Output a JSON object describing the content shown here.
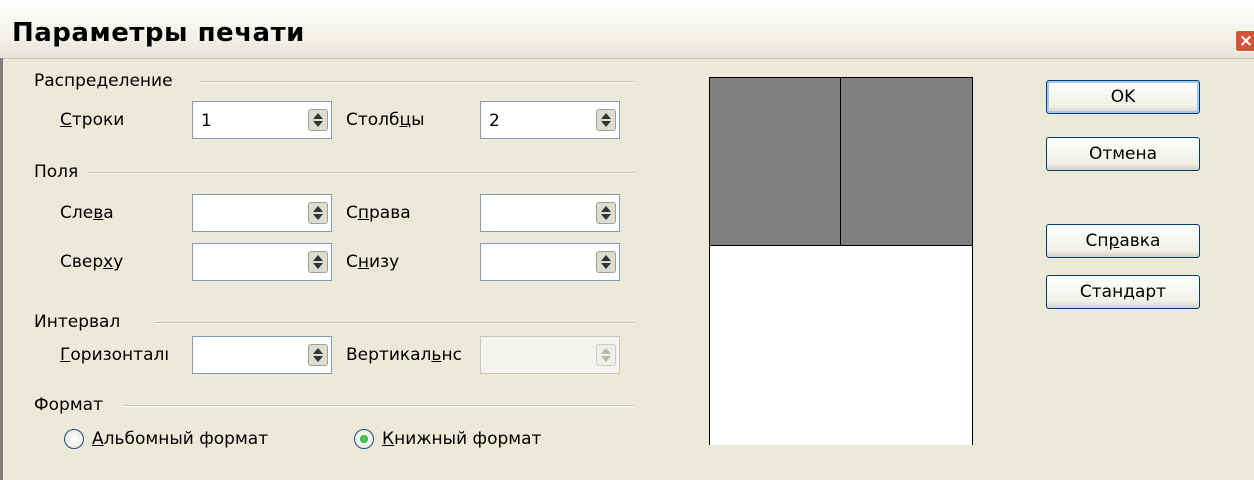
{
  "window": {
    "title": "Параметры печати",
    "close_label": "×"
  },
  "sections": {
    "distribution": "Распределение",
    "margins": "Поля",
    "spacing": "Интервал",
    "format": "Формат"
  },
  "fields": {
    "rows": {
      "u": "С",
      "rest": "троки",
      "value": "1"
    },
    "columns": {
      "pre": "Столб",
      "u": "ц",
      "post": "ы",
      "value": "2"
    },
    "left": {
      "pre": "Сле",
      "u": "в",
      "post": "а",
      "value": ""
    },
    "right": {
      "pre": "С",
      "u": "п",
      "post": "рава",
      "value": ""
    },
    "top": {
      "pre": "Свер",
      "u": "х",
      "post": "у",
      "value": ""
    },
    "bottom": {
      "pre": "С",
      "u": "н",
      "post": "изу",
      "value": ""
    },
    "horizontal": {
      "u": "Г",
      "rest": "оризонталı",
      "value": ""
    },
    "vertical": {
      "pre": "Вертикал",
      "u": "ь",
      "post": "нс",
      "value": ""
    }
  },
  "format": {
    "landscape": {
      "u": "А",
      "rest": "льбомный формат",
      "selected": false
    },
    "portrait": {
      "u": "К",
      "rest": "нижный формат",
      "selected": true
    }
  },
  "buttons": {
    "ok": "OK",
    "cancel": "Отмена",
    "help": {
      "pre": "Сп",
      "u": "р",
      "post": "авка"
    },
    "default": {
      "pre": "Стан",
      "u": "д",
      "post": "арт"
    }
  }
}
